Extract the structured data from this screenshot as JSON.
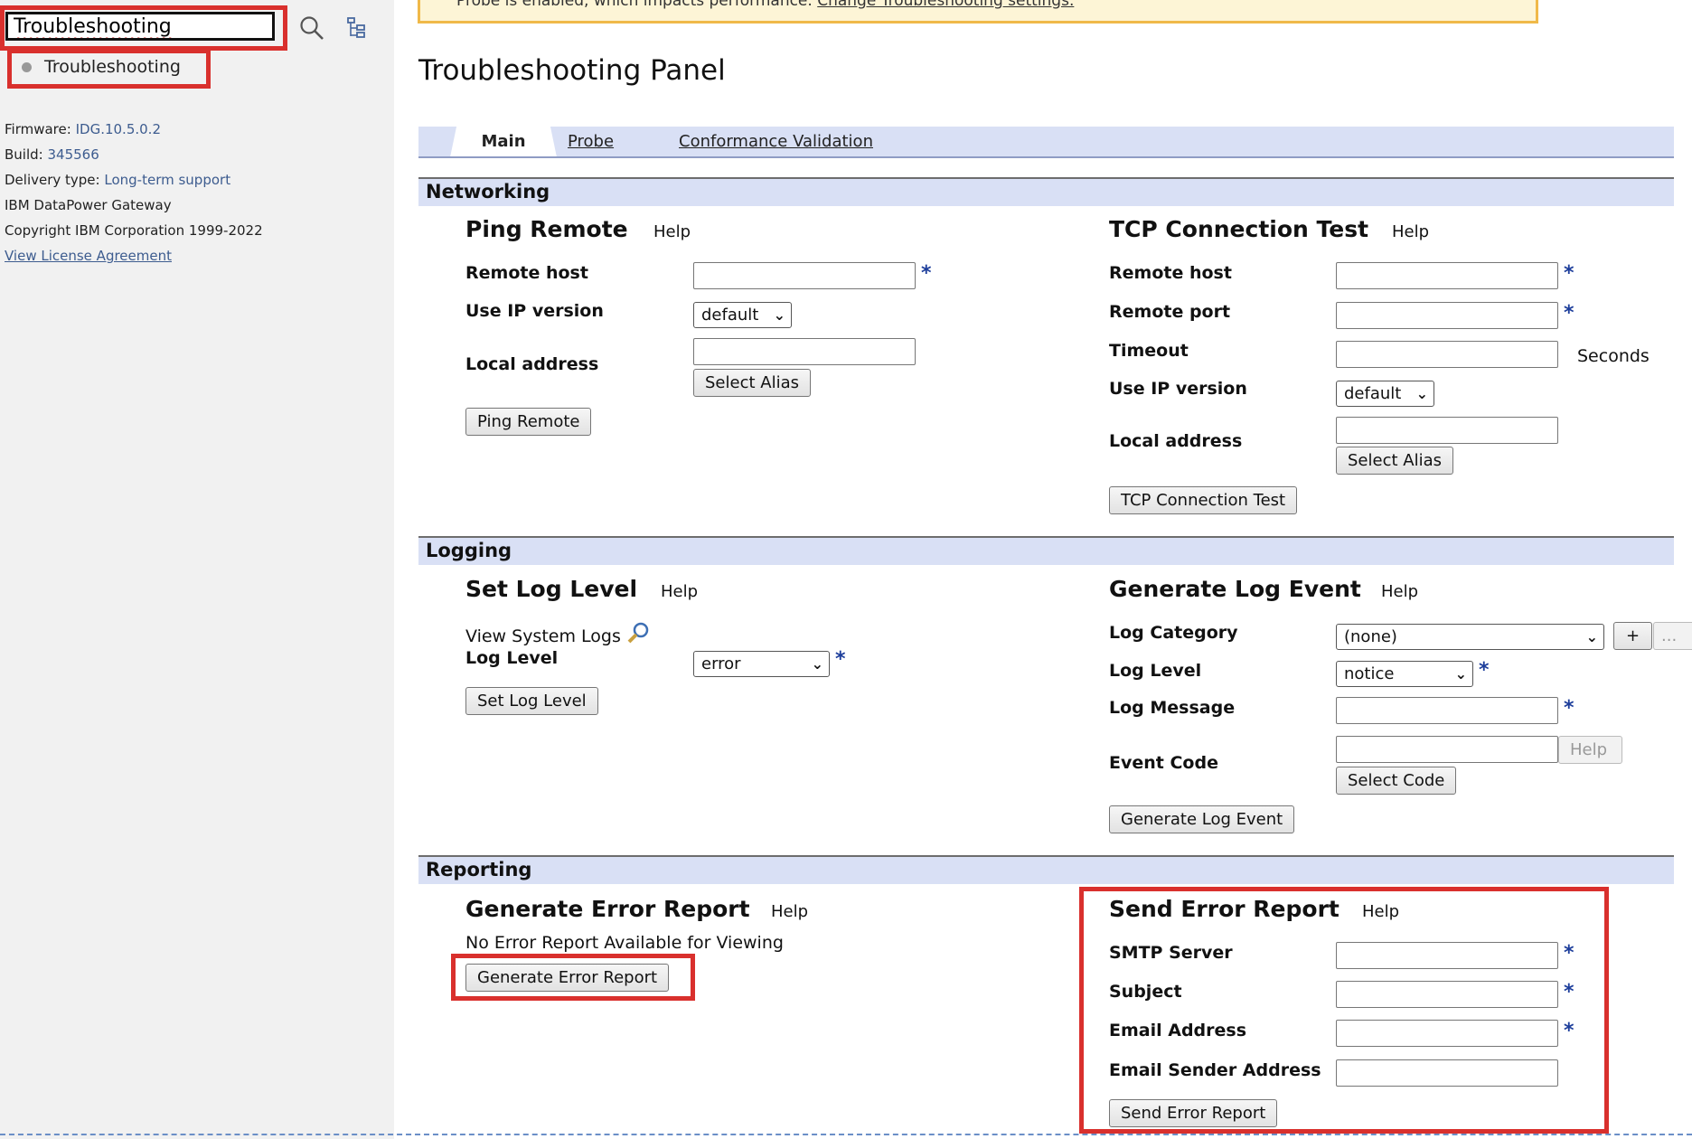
{
  "sidebar": {
    "search_value": "Troubleshooting",
    "nav_item": "Troubleshooting",
    "firmware_label": "Firmware:",
    "firmware_value": "IDG.10.5.0.2",
    "build_label": "Build:",
    "build_value": "345566",
    "delivery_label": "Delivery type:",
    "delivery_value": "Long-term support",
    "product": "IBM DataPower Gateway",
    "copyright": "Copyright IBM Corporation 1999-2022",
    "license_link": "View License Agreement"
  },
  "banner": {
    "text": "Probe is enabled, which impacts performance.",
    "link": "Change Troubleshooting settings."
  },
  "page_title": "Troubleshooting Panel",
  "tabs": [
    "Main",
    "Probe",
    "Conformance Validation"
  ],
  "networking": {
    "section": "Networking",
    "ping": {
      "title": "Ping Remote",
      "help": "Help",
      "remote_host": "Remote host",
      "ip_version": "Use IP version",
      "ip_version_value": "default",
      "local_address": "Local address",
      "select_alias": "Select Alias",
      "button": "Ping Remote"
    },
    "tcp": {
      "title": "TCP Connection Test",
      "help": "Help",
      "remote_host": "Remote host",
      "remote_port": "Remote port",
      "timeout": "Timeout",
      "seconds": "Seconds",
      "ip_version": "Use IP version",
      "ip_version_value": "default",
      "local_address": "Local address",
      "select_alias": "Select Alias",
      "button": "TCP Connection Test"
    }
  },
  "logging": {
    "section": "Logging",
    "set_level": {
      "title": "Set Log Level",
      "help": "Help",
      "view_logs": "View System Logs",
      "log_level": "Log Level",
      "log_level_value": "error",
      "button": "Set Log Level"
    },
    "generate_event": {
      "title": "Generate Log Event",
      "help": "Help",
      "category": "Log Category",
      "category_value": "(none)",
      "add": "+",
      "more": "...",
      "log_level": "Log Level",
      "log_level_value": "notice",
      "message": "Log Message",
      "event_code": "Event Code",
      "code_help": "Help",
      "select_code": "Select Code",
      "button": "Generate Log Event"
    }
  },
  "reporting": {
    "section": "Reporting",
    "generate": {
      "title": "Generate Error Report",
      "help": "Help",
      "status": "No Error Report Available for Viewing",
      "button": "Generate Error Report"
    },
    "send": {
      "title": "Send Error Report",
      "help": "Help",
      "smtp": "SMTP Server",
      "subject": "Subject",
      "email": "Email Address",
      "sender": "Email Sender Address",
      "button": "Send Error Report"
    }
  },
  "required_mark": "*",
  "colors": {
    "highlight": "#d9302d",
    "section_bar": "#d9e0f5",
    "required": "#1d3e9b",
    "link": "#3d5c8f"
  }
}
